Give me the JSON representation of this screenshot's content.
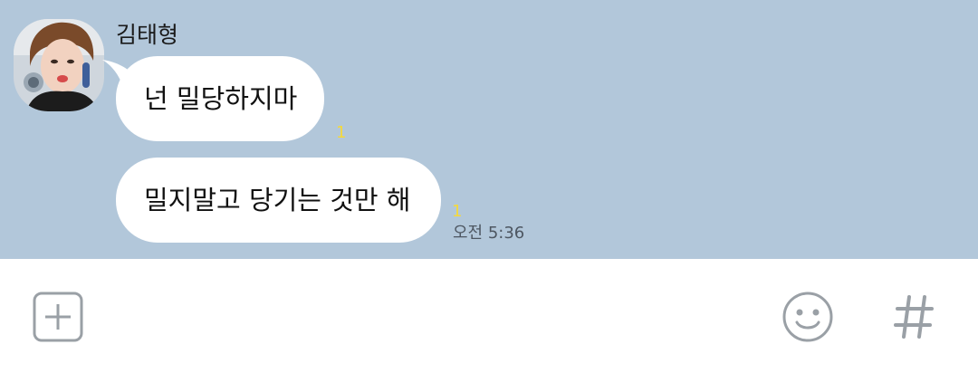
{
  "chat": {
    "sender_name": "김태형",
    "messages": [
      {
        "text": "넌 밀당하지마",
        "unread": "1"
      },
      {
        "text": "밀지말고 당기는 것만 해",
        "unread": "1"
      }
    ],
    "timestamp": "오전 5:36"
  },
  "input_bar": {
    "left_icon": "plus-square-icon",
    "right_icons": [
      "emoji-icon",
      "hashtag-icon"
    ],
    "icon_color": "#9aa0a6"
  },
  "colors": {
    "chat_background": "#b2c7da",
    "bubble": "#ffffff",
    "unread_count": "#f5d93b"
  }
}
